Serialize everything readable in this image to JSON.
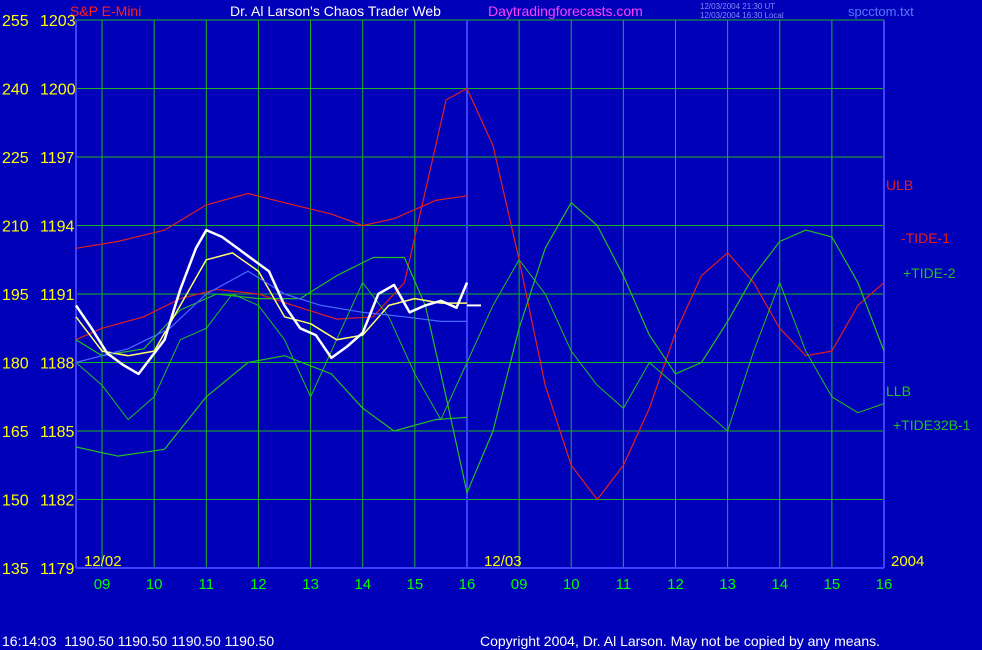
{
  "header": {
    "symbol": "S&P E-Mini",
    "title": "Dr. Al Larson's Chaos Trader Web",
    "site": "Daytradingforecasts.com",
    "time_ut": "12/03/2004 21:30 UT",
    "time_local": "12/03/2004 16:30 Local",
    "file": "spcctom.txt"
  },
  "footer": {
    "quote": "16:14:03  1190.50 1190.50 1190.50 1190.50",
    "copyright": "Copyright 2004, Dr. Al Larson. May not be copied by any means."
  },
  "colors": {
    "background": "#0000b8",
    "grid": "#1fb31f",
    "divider": "#4040ff",
    "price_up": "#ffffff",
    "price_down": "#ff2020",
    "ulb": "#e02020",
    "tide1": "#e02020",
    "tide2": "#22c022",
    "tide32": "#22c022",
    "llb": "#22c022",
    "avg_line": "#ffff66",
    "blue_line": "#4a6aff",
    "axis_text": "#ffff00",
    "time_text": "#00ff00",
    "title_text": "#ffffff",
    "site_text": "#ff40ff"
  },
  "chart_data": {
    "type": "line",
    "x_axis": {
      "hour_labels": [
        "09",
        "10",
        "11",
        "12",
        "13",
        "14",
        "15",
        "16",
        "09",
        "10",
        "11",
        "12",
        "13",
        "14",
        "15",
        "16"
      ],
      "date_labels": [
        "12/02",
        "12/03",
        "2004"
      ],
      "range_hours": [
        8.5,
        24.0
      ]
    },
    "y_axis_left": {
      "labels": [
        "255",
        "240",
        "225",
        "210",
        "195",
        "180",
        "165",
        "150",
        "135"
      ],
      "range": [
        135,
        255
      ]
    },
    "y_axis_right": {
      "labels": [
        "1203",
        "1200",
        "1197",
        "1194",
        "1191",
        "1188",
        "1185",
        "1182",
        "1179"
      ],
      "range": [
        1179,
        1203
      ]
    },
    "series_labels": {
      "ulb": "ULB",
      "tide1": "-TIDE-1",
      "tide2": "+TIDE-2",
      "llb": "LLB",
      "tide32": "+TIDE32B-1"
    },
    "series": [
      {
        "name": "ULB",
        "x": [
          8.5,
          9.3,
          10.2,
          11.0,
          11.8,
          12.5,
          13.4,
          14.0,
          14.6,
          15.4,
          16.0
        ],
        "y": [
          1193.0,
          1193.3,
          1193.8,
          1194.9,
          1195.4,
          1195.0,
          1194.5,
          1194.0,
          1194.3,
          1195.1,
          1195.3
        ]
      },
      {
        "name": "LLB",
        "x": [
          8.5,
          9.3,
          10.2,
          11.0,
          11.8,
          12.5,
          13.4,
          14.0,
          14.6,
          15.4,
          16.0
        ],
        "y": [
          1184.3,
          1183.9,
          1184.2,
          1186.5,
          1188.0,
          1188.3,
          1187.5,
          1186.0,
          1185.0,
          1185.5,
          1185.6
        ]
      },
      {
        "name": "-TIDE-1",
        "x": [
          8.5,
          9.0,
          9.8,
          10.5,
          11.2,
          12.0,
          12.8,
          13.5,
          14.2,
          14.8,
          15.2,
          15.6,
          16.0,
          16.5,
          17.0,
          17.5,
          18.0,
          18.5,
          19.0,
          19.5,
          20.0,
          20.5,
          21.0,
          21.5,
          22.0,
          22.5,
          23.0,
          23.5,
          24.0
        ],
        "y": [
          1189.0,
          1189.5,
          1190.0,
          1190.8,
          1191.2,
          1191.0,
          1190.4,
          1189.9,
          1190.0,
          1191.5,
          1195.5,
          1199.5,
          1200.0,
          1197.5,
          1192.5,
          1187.0,
          1183.5,
          1182.0,
          1183.5,
          1186.0,
          1189.3,
          1191.8,
          1192.8,
          1191.5,
          1189.5,
          1188.3,
          1188.5,
          1190.5,
          1191.5
        ]
      },
      {
        "name": "+TIDE-2",
        "x": [
          8.5,
          9.0,
          9.8,
          10.5,
          11.2,
          12.0,
          12.8,
          13.5,
          14.2,
          14.8,
          15.2,
          15.6,
          16.0,
          16.5,
          17.0,
          17.5,
          18.0,
          18.5,
          19.0,
          19.5,
          20.0,
          20.5,
          21.0,
          21.5,
          22.0,
          22.5,
          23.0,
          23.5,
          24.0
        ],
        "y": [
          1189.0,
          1188.3,
          1188.6,
          1190.3,
          1191.0,
          1190.8,
          1190.8,
          1191.8,
          1192.6,
          1192.6,
          1190.5,
          1186.5,
          1182.3,
          1185.0,
          1189.5,
          1193.0,
          1195.0,
          1194.0,
          1191.8,
          1189.2,
          1187.5,
          1188.0,
          1189.8,
          1191.8,
          1193.3,
          1193.8,
          1193.5,
          1191.5,
          1188.5
        ]
      },
      {
        "name": "+TIDE32B-1",
        "x": [
          8.5,
          9.0,
          9.5,
          10.0,
          10.5,
          11.0,
          11.5,
          12.0,
          12.5,
          13.0,
          13.5,
          14.0,
          14.5,
          15.0,
          15.5,
          16.0,
          16.5,
          17.0,
          17.5,
          18.0,
          18.5,
          19.0,
          19.5,
          20.0,
          20.5,
          21.0,
          21.5,
          22.0,
          22.5,
          23.0,
          23.5,
          24.0
        ],
        "y": [
          1188.0,
          1187.0,
          1185.5,
          1186.5,
          1189.0,
          1189.5,
          1191.0,
          1190.5,
          1189.0,
          1186.5,
          1189.0,
          1191.5,
          1190.0,
          1187.5,
          1185.5,
          1188.0,
          1190.5,
          1192.5,
          1191.0,
          1188.5,
          1187.0,
          1186.0,
          1188.0,
          1187.0,
          1186.0,
          1185.0,
          1188.5,
          1191.5,
          1188.5,
          1186.5,
          1185.8,
          1186.2
        ]
      },
      {
        "name": "price",
        "x": [
          8.5,
          8.8,
          9.1,
          9.4,
          9.7,
          10.0,
          10.2,
          10.5,
          10.8,
          11.0,
          11.3,
          11.6,
          11.9,
          12.2,
          12.5,
          12.8,
          13.1,
          13.4,
          13.7,
          14.0,
          14.3,
          14.6,
          14.9,
          15.2,
          15.5,
          15.8,
          16.0
        ],
        "y": [
          1190.5,
          1189.5,
          1188.4,
          1187.9,
          1187.5,
          1188.4,
          1189.0,
          1191.2,
          1193.0,
          1193.8,
          1193.5,
          1193.0,
          1192.5,
          1192.0,
          1190.5,
          1189.5,
          1189.2,
          1188.2,
          1188.7,
          1189.3,
          1191.0,
          1191.4,
          1190.2,
          1190.5,
          1190.7,
          1190.4,
          1191.5
        ]
      },
      {
        "name": "average",
        "x": [
          8.5,
          9.0,
          9.5,
          10.0,
          10.5,
          11.0,
          11.5,
          12.0,
          12.5,
          13.0,
          13.5,
          14.0,
          14.5,
          15.0,
          15.5,
          16.0
        ],
        "y": [
          1190.0,
          1188.5,
          1188.3,
          1188.5,
          1190.5,
          1192.5,
          1192.8,
          1192.0,
          1190.0,
          1189.7,
          1189.0,
          1189.2,
          1190.5,
          1190.8,
          1190.6,
          1190.6
        ]
      },
      {
        "name": "trend",
        "x": [
          8.5,
          9.5,
          10.3,
          11.0,
          11.8,
          12.5,
          13.2,
          14.0,
          14.8,
          15.5,
          16.0
        ],
        "y": [
          1188.0,
          1188.6,
          1189.5,
          1191.0,
          1192.0,
          1191.0,
          1190.5,
          1190.2,
          1190.0,
          1189.8,
          1189.8
        ]
      }
    ],
    "price_marker": {
      "x": 16.0,
      "y": 1190.5,
      "value": "1190.50"
    }
  }
}
